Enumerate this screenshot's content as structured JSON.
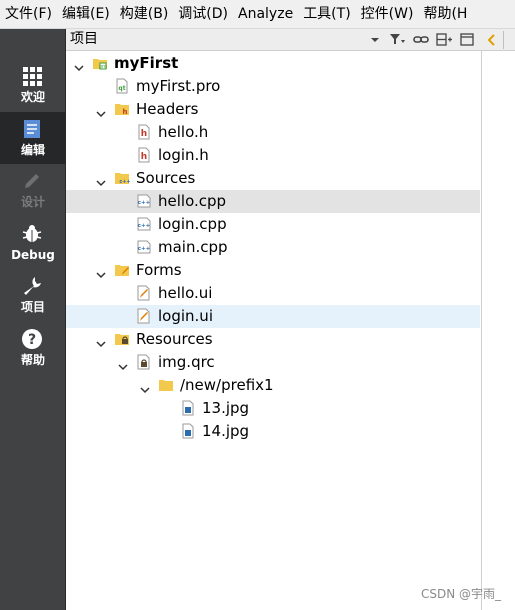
{
  "menu": [
    "文件(F)",
    "编辑(E)",
    "构建(B)",
    "调试(D)",
    "Analyze",
    "工具(T)",
    "控件(W)",
    "帮助(H"
  ],
  "modes": [
    {
      "label": "欢迎",
      "icon": "grid-icon",
      "state": "normal"
    },
    {
      "label": "编辑",
      "icon": "document-icon",
      "state": "active"
    },
    {
      "label": "设计",
      "icon": "pencil-icon",
      "state": "disabled"
    },
    {
      "label": "Debug",
      "icon": "bug-icon",
      "state": "normal"
    },
    {
      "label": "项目",
      "icon": "wrench-icon",
      "state": "normal"
    },
    {
      "label": "帮助",
      "icon": "question-icon",
      "state": "normal"
    }
  ],
  "pane": {
    "title": "项目",
    "tools": [
      "dropdown-icon",
      "filter-icon",
      "link-icon",
      "split-icon",
      "close-pane-icon"
    ]
  },
  "tree": [
    {
      "label": "myFirst",
      "level": 0,
      "expanded": true,
      "icon": "project-icon",
      "bold": true
    },
    {
      "label": "myFirst.pro",
      "level": 1,
      "icon": "pro-file-icon"
    },
    {
      "label": "Headers",
      "level": 1,
      "expanded": true,
      "icon": "headers-folder-icon"
    },
    {
      "label": "hello.h",
      "level": 2,
      "icon": "header-file-icon"
    },
    {
      "label": "login.h",
      "level": 2,
      "icon": "header-file-icon"
    },
    {
      "label": "Sources",
      "level": 1,
      "expanded": true,
      "icon": "sources-folder-icon"
    },
    {
      "label": "hello.cpp",
      "level": 2,
      "icon": "cpp-file-icon",
      "selected": true
    },
    {
      "label": "login.cpp",
      "level": 2,
      "icon": "cpp-file-icon"
    },
    {
      "label": "main.cpp",
      "level": 2,
      "icon": "cpp-file-icon"
    },
    {
      "label": "Forms",
      "level": 1,
      "expanded": true,
      "icon": "forms-folder-icon"
    },
    {
      "label": "hello.ui",
      "level": 2,
      "icon": "ui-file-icon"
    },
    {
      "label": "login.ui",
      "level": 2,
      "icon": "ui-file-icon",
      "hover": true
    },
    {
      "label": "Resources",
      "level": 1,
      "expanded": true,
      "icon": "resources-folder-icon"
    },
    {
      "label": "img.qrc",
      "level": 2,
      "expanded": true,
      "icon": "qrc-file-icon"
    },
    {
      "label": "/new/prefix1",
      "level": 3,
      "expanded": true,
      "icon": "folder-icon"
    },
    {
      "label": "13.jpg",
      "level": 4,
      "icon": "image-file-icon"
    },
    {
      "label": "14.jpg",
      "level": 4,
      "icon": "image-file-icon"
    }
  ],
  "colors": {
    "sidebar": "#404244",
    "sidebar_active": "#262728",
    "selected_row": "#e3e3e3",
    "hover_row": "#e5f1fb"
  },
  "watermark": "CSDN @宇雨_"
}
